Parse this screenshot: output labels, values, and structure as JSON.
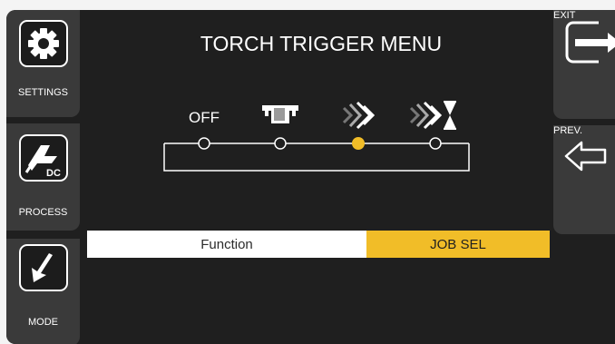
{
  "header": {
    "title": "TORCH TRIGGER MENU"
  },
  "left_buttons": [
    {
      "label": "SETTINGS",
      "icon": "gear-icon"
    },
    {
      "label": "PROCESS",
      "icon": "dc-process-icon",
      "badge": "DC"
    },
    {
      "label": "MODE",
      "icon": "mode-arrow-icon"
    }
  ],
  "right_buttons": [
    {
      "label": "EXIT",
      "icon": "exit-icon"
    },
    {
      "label": "PREV.",
      "icon": "back-arrow-icon"
    }
  ],
  "trigger_options": {
    "off_label": "OFF",
    "selected_index": 2,
    "options": [
      "OFF",
      "2-step-icon",
      "4-step-icon",
      "4-step-timer-icon"
    ]
  },
  "menu_row": {
    "function_label": "Function",
    "value": "JOB SEL"
  },
  "colors": {
    "accent": "#f1bd28",
    "panel": "#3a3a3a",
    "background": "#1f1f1f"
  }
}
